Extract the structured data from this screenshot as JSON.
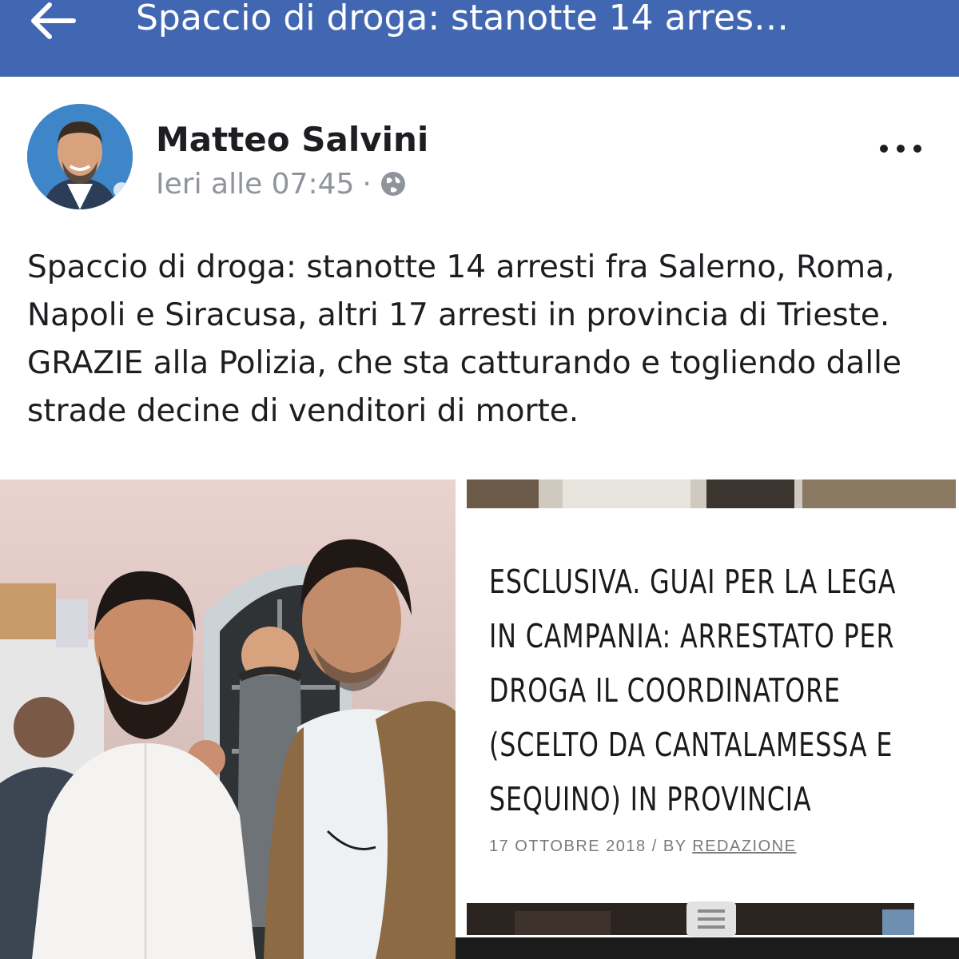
{
  "header": {
    "title": "Spaccio di droga: stanotte 14 arres…",
    "back_icon": "arrow-left-icon",
    "background_color": "#4267b2"
  },
  "post": {
    "author": "Matteo Salvini",
    "timestamp": "Ieri alle 07:45",
    "separator": "·",
    "privacy_icon": "globe-icon",
    "more_icon": "more-horizontal-icon",
    "text": "Spaccio di droga: stanotte 14 arresti fra Salerno, Roma, Napoli e Siracusa, altri 17 arresti in provincia di Trieste. GRAZIE alla Polizia, che sta catturando e togliendo dalle strade decine di venditori di morte."
  },
  "article": {
    "headline": "ESCLUSIVA. GUAI PER LA LEGA IN CAMPANIA: ARRESTATO PER DROGA IL COORDINATORE (SCELTO DA CANTALAMESSA E SEQUINO) IN PROVINCIA",
    "date": "17 OTTOBRE 2018",
    "meta_separator": "/",
    "by_label": "BY",
    "author_link": "REDAZIONE",
    "menu_icon": "menu-icon"
  }
}
